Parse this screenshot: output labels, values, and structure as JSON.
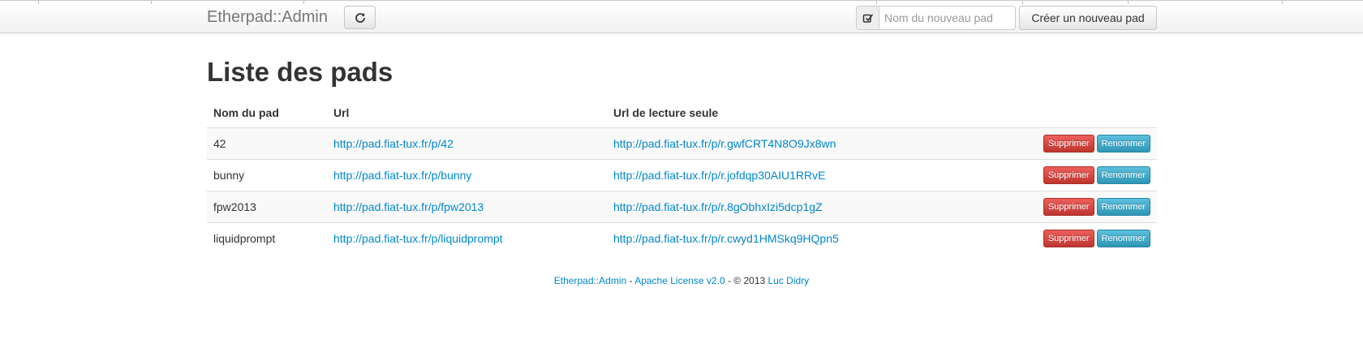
{
  "navbar": {
    "brand": "Etherpad::Admin",
    "refresh_icon": "refresh-icon",
    "edit_icon": "edit-icon",
    "new_pad_placeholder": "Nom du nouveau pad",
    "new_pad_value": "",
    "create_button": "Créer un nouveau pad"
  },
  "main": {
    "title": "Liste des pads",
    "table": {
      "headers": [
        "Nom du pad",
        "Url",
        "Url de lecture seule",
        ""
      ],
      "rows": [
        {
          "name": "42",
          "url": "http://pad.fiat-tux.fr/p/42",
          "readonly_url": "http://pad.fiat-tux.fr/p/r.gwfCRT4N8O9Jx8wn",
          "delete": "Supprimer",
          "rename": "Renommer"
        },
        {
          "name": "bunny",
          "url": "http://pad.fiat-tux.fr/p/bunny",
          "readonly_url": "http://pad.fiat-tux.fr/p/r.jofdqp30AIU1RRvE",
          "delete": "Supprimer",
          "rename": "Renommer"
        },
        {
          "name": "fpw2013",
          "url": "http://pad.fiat-tux.fr/p/fpw2013",
          "readonly_url": "http://pad.fiat-tux.fr/p/r.8gObhxIzi5dcp1gZ",
          "delete": "Supprimer",
          "rename": "Renommer"
        },
        {
          "name": "liquidprompt",
          "url": "http://pad.fiat-tux.fr/p/liquidprompt",
          "readonly_url": "http://pad.fiat-tux.fr/p/r.cwyd1HMSkq9HQpn5",
          "delete": "Supprimer",
          "rename": "Renommer"
        }
      ]
    }
  },
  "footer": {
    "app_link": "Etherpad::Admin",
    "sep1": " - ",
    "license_link": "Apache License v2.0",
    "sep2": " - © 2013 ",
    "author_link": "Luc Didry"
  },
  "colors": {
    "link": "#0088cc",
    "danger": "#da4f49",
    "info": "#49afcd"
  }
}
